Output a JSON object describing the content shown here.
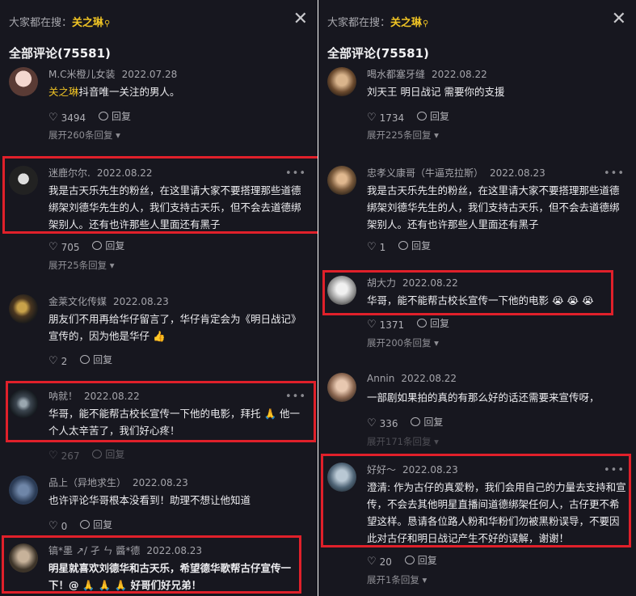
{
  "left": {
    "searchbar": {
      "prefix": "大家都在搜：",
      "keyword": "关之琳"
    },
    "heading": "全部评论(75581)",
    "comments": [
      {
        "user": "M.C米橙儿女装",
        "date": "2022.07.28",
        "mention": "关之琳",
        "text": "抖音唯一关注的男人。",
        "likes": "3494",
        "reply": "回复",
        "expand": "展开260条回复"
      },
      {
        "user": "迷鹿尔尔.",
        "date": "2022.08.22",
        "text": "我是古天乐先生的粉丝，在这里请大家不要搭理那些道德绑架刘德华先生的人，我们支持古天乐，但不会去道德绑架别人。还有也许那些人里面还有黑子",
        "likes": "705",
        "reply": "回复",
        "expand": "展开25条回复"
      },
      {
        "user": "金莱文化传媒",
        "date": "2022.08.23",
        "text": "朋友们不用再给华仔留言了，华仔肯定会为《明日战记》宣传的，因为他是华仔 👍",
        "likes": "2",
        "reply": "回复"
      },
      {
        "user": "呐就！",
        "date": "2022.08.22",
        "text": "华哥，能不能帮古校长宣传一下他的电影，拜托 🙏 他一个人太辛苦了，我们好心疼！",
        "likes": "267",
        "reply": "回复"
      },
      {
        "user": "品上（异地求生）",
        "date": "2022.08.23",
        "text": "也许评论华哥根本没看到！助理不想让他知道",
        "likes": "0",
        "reply": "回复"
      },
      {
        "user": "镐*墨 ↗/ 孑 ㄣ 醬*德",
        "date": "2022.08.23",
        "text": "明星就喜欢刘德华和古天乐，希望德华歌帮古仔宣传一下！@ 🙏 🙏 🙏 好哥们好兄弟！"
      }
    ]
  },
  "right": {
    "searchbar": {
      "prefix": "大家都在搜：",
      "keyword": "关之琳"
    },
    "heading": "全部评论(75581)",
    "comments": [
      {
        "user": "喝水都塞牙缝",
        "date": "2022.08.22",
        "text": "刘天王 明日战记 需要你的支援",
        "likes": "1734",
        "reply": "回复",
        "expand": "展开225条回复"
      },
      {
        "user": "忠孝义康哥（牛逼克拉斯）",
        "date": "2022.08.23",
        "text": "我是古天乐先生的粉丝，在这里请大家不要搭理那些道德绑架刘德华先生的人，我们支持古天乐，但不会去道德绑架别人。还有也许那些人里面还有黑子",
        "likes": "1",
        "reply": "回复"
      },
      {
        "user": "胡大力",
        "date": "2022.08.22",
        "text": "华哥，能不能帮古校长宣传一下他的电影 😭 😭 😭",
        "likes": "1371",
        "reply": "回复",
        "expand": "展开200条回复"
      },
      {
        "user": "Annin",
        "date": "2022.08.22",
        "text": "一部剧如果拍的真的有那么好的话还需要来宣传呀，",
        "likes": "336",
        "reply": "回复",
        "expand": "展开171条回复"
      },
      {
        "user": "好好～",
        "date": "2022.08.23",
        "text": "澄清: 作为古仔的真爱粉，我们会用自己的力量去支持和宣传，不会去其他明星直播间道德绑架任何人，古仔更不希望这样。恳请各位路人粉和华粉们勿被黑粉误导，不要因此对古仔和明日战记产生不好的误解，谢谢！",
        "likes": "20",
        "reply": "回复",
        "expand": "展开1条回复"
      }
    ]
  },
  "colors": {
    "background": "#17171f",
    "highlight": "#e0202a",
    "keyword": "#f0c424"
  },
  "icons": {
    "close": "close-icon",
    "like": "heart-icon",
    "reply": "comment-bubble-icon",
    "search": "search-sparkle-icon"
  }
}
